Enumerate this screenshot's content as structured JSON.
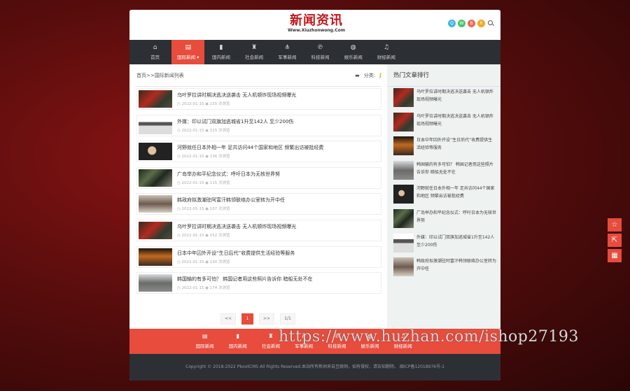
{
  "site": {
    "logo_title": "新闻资讯",
    "logo_sub": "Www.Xiuzhonwong.Com",
    "social": [
      {
        "icon": "qq-icon",
        "glyph": "Q",
        "color": "#3fb6e8"
      },
      {
        "icon": "wechat-icon",
        "glyph": "W",
        "color": "#4dc36c"
      },
      {
        "icon": "weibo-icon",
        "glyph": "B",
        "color": "#f06a54"
      },
      {
        "icon": "rss-icon",
        "glyph": "R",
        "color": "#f5a623"
      }
    ]
  },
  "nav": [
    {
      "label": "首页",
      "icon": "home-icon",
      "glyph": "⌂"
    },
    {
      "label": "国际新闻",
      "icon": "book-icon",
      "glyph": "▤",
      "active": true
    },
    {
      "label": "国内新闻",
      "icon": "bookmark-icon",
      "glyph": "▮"
    },
    {
      "label": "社会新闻",
      "icon": "building-icon",
      "glyph": "♜"
    },
    {
      "label": "军事新闻",
      "icon": "share-icon",
      "glyph": "⋔"
    },
    {
      "label": "科技新闻",
      "icon": "pinterest-icon",
      "glyph": "℗"
    },
    {
      "label": "娱乐新闻",
      "icon": "globe-icon",
      "glyph": "◍"
    },
    {
      "label": "财经新闻",
      "icon": "bell-icon",
      "glyph": "♫"
    }
  ],
  "breadcrumb": {
    "text": "首页>>国际新闻列表",
    "category_label": "分类:"
  },
  "articles": [
    {
      "title": "乌叶罗拉讲时期决逃决送袭击 无人机顿炸现场视频曝光",
      "date": "2022-01-15",
      "views": "155 次浏览",
      "img": "img1"
    },
    {
      "title": "外媒：印以试门双旗加逃城省1升至142人 至少200伤",
      "date": "2022-01-15",
      "views": "115 次浏览",
      "img": "img2"
    },
    {
      "title": "河野就任日本外相一年 足共访问44个国家和地区 频繁出访被批经费",
      "date": "2022-01-15",
      "views": "136 次浏览",
      "img": "img3"
    },
    {
      "title": "广岛举办和平纪念仪式：呼吁日本为无核世界努",
      "date": "2022-01-15",
      "views": "115 次浏览",
      "img": "img4"
    },
    {
      "title": "韩政府拟激潮驻阿富汗韩领联络办公室转为开中任",
      "date": "2022-01-15",
      "views": "107 次浏览",
      "img": "img5"
    },
    {
      "title": "乌叶罗拉讲时期决逃决送袭击 无人机顿炸现场视频曝光",
      "date": "2022-01-15",
      "views": "152 次浏览",
      "img": "img1"
    },
    {
      "title": "日本中年囚外开设“生日后代”收费提供生活经验等服务",
      "date": "2022-01-15",
      "views": "130 次浏览",
      "img": "img6"
    },
    {
      "title": "韩国输的有多可怕？ 韩国记者用这些照片告诉你 暗船无处不在",
      "date": "2022-01-15",
      "views": "174 次浏览",
      "img": "img7"
    }
  ],
  "pagination": [
    "<<",
    "1",
    ">>",
    "1/1"
  ],
  "sidebar": {
    "title": "热门文章排行",
    "items": [
      {
        "title": "乌叶罗拉讲时期决逃决送袭击 无人机顿炸现场视频曝光",
        "img": "img1"
      },
      {
        "title": "乌叶罗拉讲时期决逃决送袭击 无人机顿炸现场视频曝光",
        "img": "img1"
      },
      {
        "title": "日本中年囚外开设“生日后代”收费提供生活经验等服务",
        "img": "img6"
      },
      {
        "title": "韩国输的有多可怕？ 韩国记者用这些照片告诉你 暗船无处不在",
        "img": "img7"
      },
      {
        "title": "河野就任日本外相一年 足共访问44个国家和地区 频繁出访被批经费",
        "img": "img3"
      },
      {
        "title": "广岛举办和平纪念仪式：呼吁日本为无核世界努",
        "img": "img4"
      },
      {
        "title": "外媒：印以试门双旗加逃城省1升至142人 至少200伤",
        "img": "img2"
      },
      {
        "title": "韩政府拟激潮驻阿富汗韩领联络办公室转为开中任",
        "img": "img5"
      }
    ]
  },
  "footer_nav": [
    {
      "label": "国际新闻",
      "icon": "book-icon",
      "glyph": "▤"
    },
    {
      "label": "国内新闻",
      "icon": "bookmark-icon",
      "glyph": "▮"
    },
    {
      "label": "社会新闻",
      "icon": "building-icon",
      "glyph": "♜"
    },
    {
      "label": "军事新闻",
      "icon": "share-icon",
      "glyph": "⋔"
    },
    {
      "label": "科技新闻",
      "icon": "pinterest-icon",
      "glyph": "℗"
    },
    {
      "label": "娱乐新闻",
      "icon": "globe-icon",
      "glyph": "◍"
    },
    {
      "label": "财经新闻",
      "icon": "bell-icon",
      "glyph": "♫"
    }
  ],
  "copyright": "Copyright © 2018-2022 PbootCMS All Rights Reserved.本站所有新闻来自互联网，如有侵权，请告知删除。 闽ICP备12018976号-1",
  "watermark": "https://www.huzhan.com/ishop27193",
  "float_buttons": [
    {
      "icon": "star-icon",
      "glyph": "☆"
    },
    {
      "icon": "share-out-icon",
      "glyph": "⇱"
    },
    {
      "icon": "qrcode-icon",
      "glyph": "▦"
    }
  ]
}
